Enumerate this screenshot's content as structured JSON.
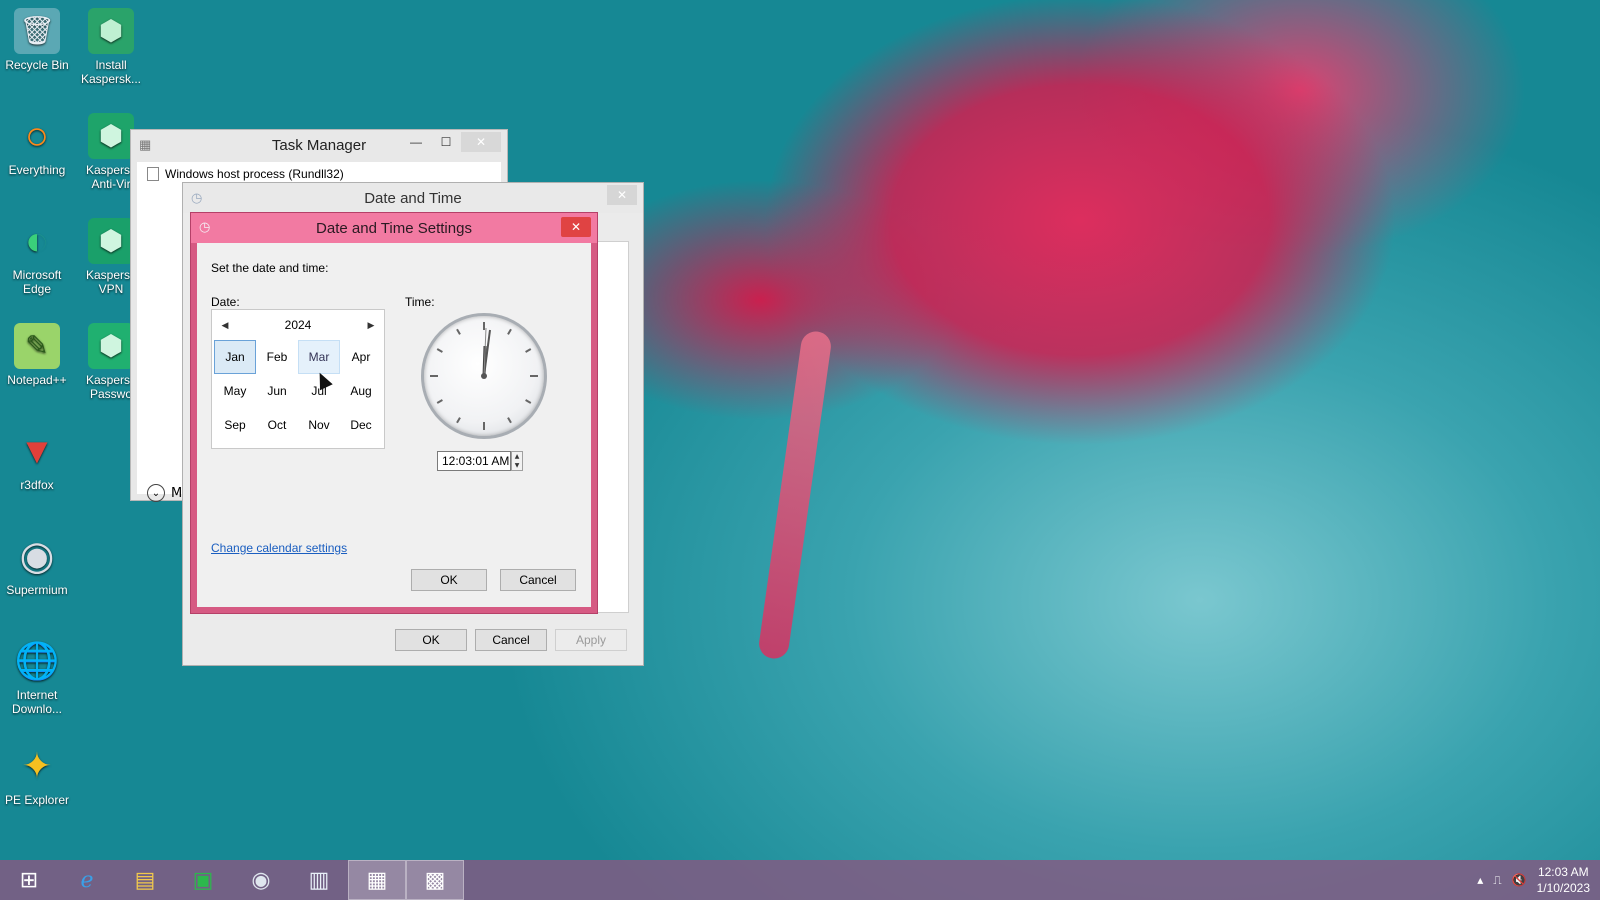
{
  "desktop": {
    "icons": [
      {
        "label": "Recycle Bin",
        "glyph": "🗑"
      },
      {
        "label": "Install Kaspersk...",
        "glyph": "⬢"
      },
      {
        "label": "Everything",
        "glyph": "○"
      },
      {
        "label": "Kaspersk Anti-Vir",
        "glyph": "⬢"
      },
      {
        "label": "Microsoft Edge",
        "glyph": "◐"
      },
      {
        "label": "Kaspersk VPN",
        "glyph": "⬢"
      },
      {
        "label": "Notepad++",
        "glyph": "✎"
      },
      {
        "label": "Kaspersk Passwo",
        "glyph": "⬢"
      },
      {
        "label": "r3dfox",
        "glyph": "▼"
      },
      {
        "label": "Supermium",
        "glyph": "◉"
      },
      {
        "label": "Internet Downlo...",
        "glyph": "🌐"
      },
      {
        "label": "PE Explorer",
        "glyph": "✦"
      }
    ]
  },
  "task_manager": {
    "title": "Task Manager",
    "process": "Windows host process (Rundll32)",
    "more_details": "M"
  },
  "date_time_outer": {
    "title": "Date and Time",
    "ok": "OK",
    "cancel": "Cancel",
    "apply": "Apply"
  },
  "date_time_settings": {
    "title": "Date and Time Settings",
    "instruction": "Set the date and time:",
    "date_label": "Date:",
    "time_label": "Time:",
    "year": "2024",
    "months": [
      "Jan",
      "Feb",
      "Mar",
      "Apr",
      "May",
      "Jun",
      "Jul",
      "Aug",
      "Sep",
      "Oct",
      "Nov",
      "Dec"
    ],
    "selected_month": "Jan",
    "hover_month": "Mar",
    "time_value": "12:03:01 AM",
    "link": "Change calendar settings",
    "ok": "OK",
    "cancel": "Cancel"
  },
  "taskbar": {
    "time": "12:03 AM",
    "date": "1/10/2023"
  },
  "colors": {
    "dialog_accent": "#f27aa2",
    "dialog_border": "#d65a83",
    "taskbar": "#825a82",
    "link": "#1a5ec0"
  }
}
